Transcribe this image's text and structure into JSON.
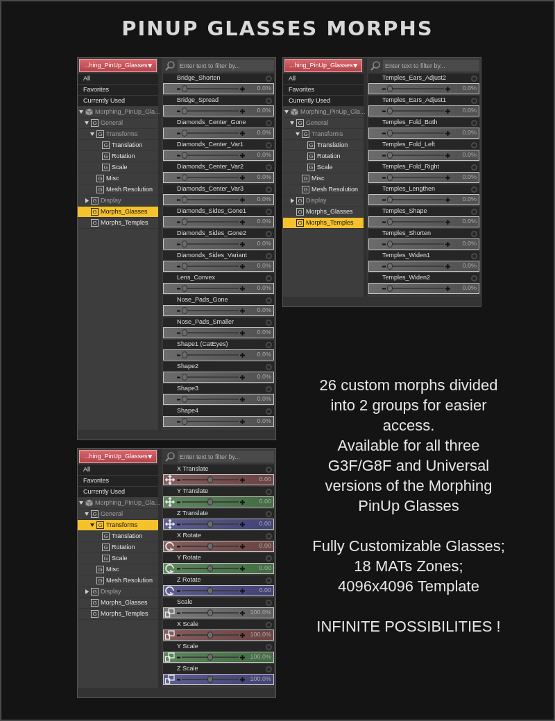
{
  "title": "PINUP GLASSES MORPHS",
  "panels": [
    {
      "dropdown": "...hing_PinUp_Glasses",
      "filter_placeholder": "Enter text to filter by...",
      "tree": [
        {
          "kind": "category",
          "label": "All",
          "selected": false
        },
        {
          "kind": "category",
          "label": "Favorites",
          "selected": false
        },
        {
          "kind": "category",
          "label": "Currently Used",
          "selected": false
        },
        {
          "kind": "figure",
          "label": "Morphing_PinUp_Gla...",
          "expanded": true,
          "dimmed": true,
          "selected": false,
          "children": [
            {
              "kind": "group",
              "badge": "G",
              "label": "General",
              "expanded": true,
              "dimmed": true,
              "selected": false,
              "children": [
                {
                  "kind": "group",
                  "badge": "G",
                  "label": "Transforms",
                  "expanded": true,
                  "dimmed": true,
                  "selected": false,
                  "children": [
                    {
                      "kind": "group",
                      "badge": "G",
                      "label": "Translation",
                      "dimmed": false,
                      "selected": false
                    },
                    {
                      "kind": "group",
                      "badge": "G",
                      "label": "Rotation",
                      "dimmed": false,
                      "selected": false
                    },
                    {
                      "kind": "group",
                      "badge": "G",
                      "label": "Scale",
                      "dimmed": false,
                      "selected": false
                    }
                  ]
                },
                {
                  "kind": "group",
                  "badge": "G",
                  "label": "Misc",
                  "dimmed": false,
                  "selected": false
                },
                {
                  "kind": "group",
                  "badge": "G",
                  "label": "Mesh Resolution",
                  "dimmed": false,
                  "selected": false
                }
              ]
            },
            {
              "kind": "group",
              "badge": "G",
              "label": "Display",
              "expanded": false,
              "dimmed": true,
              "selected": false
            },
            {
              "kind": "group",
              "badge": "G",
              "label": "Morphs_Glasses",
              "dimmed": false,
              "selected": true
            },
            {
              "kind": "group",
              "badge": "G",
              "label": "Morphs_Temples",
              "dimmed": false,
              "selected": false
            }
          ]
        }
      ],
      "sliders": [
        {
          "kind": "morph",
          "label": "Bridge_Shorten",
          "level": 0,
          "value": "0.0%"
        },
        {
          "kind": "morph",
          "label": "Bridge_Spread",
          "level": 0,
          "value": "0.0%"
        },
        {
          "kind": "morph",
          "label": "Diamonds_Center_Gone",
          "level": 0,
          "value": "0.0%"
        },
        {
          "kind": "morph",
          "label": "Diamonds_Center_Var1",
          "level": 0,
          "value": "0.0%"
        },
        {
          "kind": "morph",
          "label": "Diamonds_Center_Var2",
          "level": 0,
          "value": "0.0%"
        },
        {
          "kind": "morph",
          "label": "Diamonds_Center_Var3",
          "level": 0,
          "value": "0.0%"
        },
        {
          "kind": "morph",
          "label": "Diamonds_Sides_Gone1",
          "level": 0,
          "value": "0.0%"
        },
        {
          "kind": "morph",
          "label": "Diamonds_Sides_Gone2",
          "level": 0,
          "value": "0.0%"
        },
        {
          "kind": "morph",
          "label": "Diamonds_Sides_Variant",
          "level": 0,
          "value": "0.0%"
        },
        {
          "kind": "morph",
          "label": "Lens_Convex",
          "level": 0,
          "value": "0.0%"
        },
        {
          "kind": "morph",
          "label": "Nose_Pads_Gone",
          "level": 0,
          "value": "0.0%"
        },
        {
          "kind": "morph",
          "label": "Nose_Pads_Smaller",
          "level": 0,
          "value": "0.0%"
        },
        {
          "kind": "morph",
          "label": "Shape1 (CatEyes)",
          "level": 0,
          "value": "0.0%"
        },
        {
          "kind": "morph",
          "label": "Shape2",
          "level": 0,
          "value": "0.0%"
        },
        {
          "kind": "morph",
          "label": "Shape3",
          "level": 0,
          "value": "0.0%"
        },
        {
          "kind": "morph",
          "label": "Shape4",
          "level": 0,
          "value": "0.0%"
        }
      ]
    },
    {
      "dropdown": "...hing_PinUp_Glasses",
      "filter_placeholder": "Enter text to filter by...",
      "tree": [
        {
          "kind": "category",
          "label": "All",
          "selected": false
        },
        {
          "kind": "category",
          "label": "Favorites",
          "selected": false
        },
        {
          "kind": "category",
          "label": "Currently Used",
          "selected": false
        },
        {
          "kind": "figure",
          "label": "Morphing_PinUp_Gla...",
          "expanded": true,
          "dimmed": true,
          "selected": false,
          "children": [
            {
              "kind": "group",
              "badge": "G",
              "label": "General",
              "expanded": true,
              "dimmed": true,
              "selected": false,
              "children": [
                {
                  "kind": "group",
                  "badge": "G",
                  "label": "Transforms",
                  "expanded": true,
                  "dimmed": true,
                  "selected": false,
                  "children": [
                    {
                      "kind": "group",
                      "badge": "G",
                      "label": "Translation",
                      "dimmed": false,
                      "selected": false
                    },
                    {
                      "kind": "group",
                      "badge": "G",
                      "label": "Rotation",
                      "dimmed": false,
                      "selected": false
                    },
                    {
                      "kind": "group",
                      "badge": "G",
                      "label": "Scale",
                      "dimmed": false,
                      "selected": false
                    }
                  ]
                },
                {
                  "kind": "group",
                  "badge": "G",
                  "label": "Misc",
                  "dimmed": false,
                  "selected": false
                },
                {
                  "kind": "group",
                  "badge": "G",
                  "label": "Mesh Resolution",
                  "dimmed": false,
                  "selected": false
                }
              ]
            },
            {
              "kind": "group",
              "badge": "G",
              "label": "Display",
              "expanded": false,
              "dimmed": true,
              "selected": false
            },
            {
              "kind": "group",
              "badge": "G",
              "label": "Morphs_Glasses",
              "dimmed": false,
              "selected": false
            },
            {
              "kind": "group",
              "badge": "G",
              "label": "Morphs_Temples",
              "dimmed": false,
              "selected": true
            }
          ]
        }
      ],
      "sliders": [
        {
          "kind": "morph",
          "label": "Temples_Ears_Adjust2",
          "level": 0,
          "value": "0.0%"
        },
        {
          "kind": "morph",
          "label": "Temples_Ears_Adjust1",
          "level": 0,
          "value": "0.0%"
        },
        {
          "kind": "morph",
          "label": "Temples_Fold_Both",
          "level": 0,
          "value": "0.0%"
        },
        {
          "kind": "morph",
          "label": "Temples_Fold_Left",
          "level": 0,
          "value": "0.0%"
        },
        {
          "kind": "morph",
          "label": "Temples_Fold_Right",
          "level": 0,
          "value": "0.0%"
        },
        {
          "kind": "morph",
          "label": "Temples_Lengthen",
          "level": 0,
          "value": "0.0%"
        },
        {
          "kind": "morph",
          "label": "Temples_Shape",
          "level": 0,
          "value": "0.0%"
        },
        {
          "kind": "morph",
          "label": "Temples_Shorten",
          "level": 0,
          "value": "0.0%"
        },
        {
          "kind": "morph",
          "label": "Temples_Widen1",
          "level": 0,
          "value": "0.0%"
        },
        {
          "kind": "morph",
          "label": "Temples_Widen2",
          "level": 0,
          "value": "0.0%"
        }
      ]
    },
    {
      "dropdown": "...hing_PinUp_Glasses",
      "filter_placeholder": "Enter text to filter by...",
      "tree": [
        {
          "kind": "category",
          "label": "All",
          "selected": false
        },
        {
          "kind": "category",
          "label": "Favorites",
          "selected": false
        },
        {
          "kind": "category",
          "label": "Currently Used",
          "selected": false
        },
        {
          "kind": "figure",
          "label": "Morphing_PinUp_Gla...",
          "expanded": true,
          "dimmed": true,
          "selected": false,
          "children": [
            {
              "kind": "group",
              "badge": "G",
              "label": "General",
              "expanded": true,
              "dimmed": true,
              "selected": false,
              "children": [
                {
                  "kind": "group",
                  "badge": "G",
                  "label": "Transforms",
                  "expanded": true,
                  "dimmed": false,
                  "selected": true,
                  "children": [
                    {
                      "kind": "group",
                      "badge": "G",
                      "label": "Translation",
                      "dimmed": false,
                      "selected": false
                    },
                    {
                      "kind": "group",
                      "badge": "G",
                      "label": "Rotation",
                      "dimmed": false,
                      "selected": false
                    },
                    {
                      "kind": "group",
                      "badge": "G",
                      "label": "Scale",
                      "dimmed": false,
                      "selected": false
                    }
                  ]
                },
                {
                  "kind": "group",
                  "badge": "G",
                  "label": "Misc",
                  "dimmed": false,
                  "selected": false
                },
                {
                  "kind": "group",
                  "badge": "G",
                  "label": "Mesh Resolution",
                  "dimmed": false,
                  "selected": false
                }
              ]
            },
            {
              "kind": "group",
              "badge": "G",
              "label": "Display",
              "expanded": false,
              "dimmed": true,
              "selected": false
            },
            {
              "kind": "group",
              "badge": "G",
              "label": "Morphs_Glasses",
              "dimmed": false,
              "selected": false
            },
            {
              "kind": "group",
              "badge": "G",
              "label": "Morphs_Temples",
              "dimmed": false,
              "selected": false
            }
          ]
        }
      ],
      "sliders": [
        {
          "kind": "translate",
          "label": "X Translate",
          "level": 0.5,
          "value": "0.00",
          "color": "#7a4c4c"
        },
        {
          "kind": "translate",
          "label": "Y Translate",
          "level": 0.5,
          "value": "0.00",
          "color": "#4c7a4c"
        },
        {
          "kind": "translate",
          "label": "Z Translate",
          "level": 0.5,
          "value": "0.00",
          "color": "#4c4c84"
        },
        {
          "kind": "rotate",
          "label": "X Rotate",
          "level": 0.5,
          "value": "0.00",
          "color": "#7a4c4c"
        },
        {
          "kind": "rotate",
          "label": "Y Rotate",
          "level": 0.5,
          "value": "0.00",
          "color": "#4c7a4c"
        },
        {
          "kind": "rotate",
          "label": "Z Rotate",
          "level": 0.5,
          "value": "0.00",
          "color": "#4c4c84"
        },
        {
          "kind": "scale",
          "label": "Scale",
          "level": 0.5,
          "value": "100.0%",
          "color": "#6c6c6c"
        },
        {
          "kind": "scale",
          "label": "X Scale",
          "level": 0.5,
          "value": "100.0%",
          "color": "#7a4c4c"
        },
        {
          "kind": "scale",
          "label": "Y Scale",
          "level": 0.5,
          "value": "100.0%",
          "color": "#4c7a4c"
        },
        {
          "kind": "scale",
          "label": "Z Scale",
          "level": 0.5,
          "value": "100.0%",
          "color": "#4c4c84"
        }
      ]
    }
  ],
  "description": [
    {
      "lines": [
        "26 custom morphs divided",
        "into 2 groups for easier",
        "access.",
        "Available for all three",
        "G3F/G8F and Universal",
        "versions of the Morphing",
        "PinUp Glasses"
      ]
    },
    {
      "lines": [
        "Fully Customizable Glasses;",
        "18 MATs Zones;",
        "4096x4096 Template"
      ]
    },
    {
      "lines": [
        "INFINITE POSSIBILITIES !"
      ]
    }
  ]
}
